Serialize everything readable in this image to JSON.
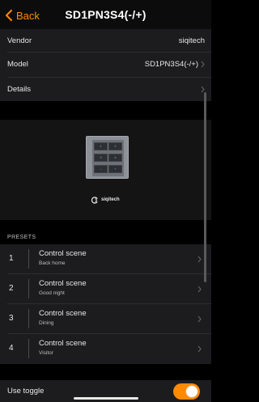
{
  "nav": {
    "back_label": "Back",
    "title": "SD1PN3S4(-/+)"
  },
  "info": {
    "vendor_label": "Vendor",
    "vendor_value": "siqitech",
    "model_label": "Model",
    "model_value": "SD1PN3S4(-/+)",
    "details_label": "Details"
  },
  "device": {
    "keys": [
      "1",
      "2",
      "3",
      "4",
      "–",
      "+"
    ],
    "brand": "siqitech"
  },
  "presets": {
    "header": "PRESETS",
    "items": [
      {
        "number": "1",
        "name": "Control scene",
        "subtitle": "Back home"
      },
      {
        "number": "2",
        "name": "Control scene",
        "subtitle": "Good night"
      },
      {
        "number": "3",
        "name": "Control scene",
        "subtitle": "Dining"
      },
      {
        "number": "4",
        "name": "Control scene",
        "subtitle": "Visitor"
      }
    ]
  },
  "use_toggle": {
    "label": "Use toggle",
    "enabled": true
  },
  "colors": {
    "accent": "#ff8a00",
    "background": "#000000",
    "cell": "#1c1c1e"
  },
  "icons": {
    "back": "chevron-left-icon",
    "disclosure": "chevron-right-icon",
    "brand": "siqitech-logo-icon"
  }
}
